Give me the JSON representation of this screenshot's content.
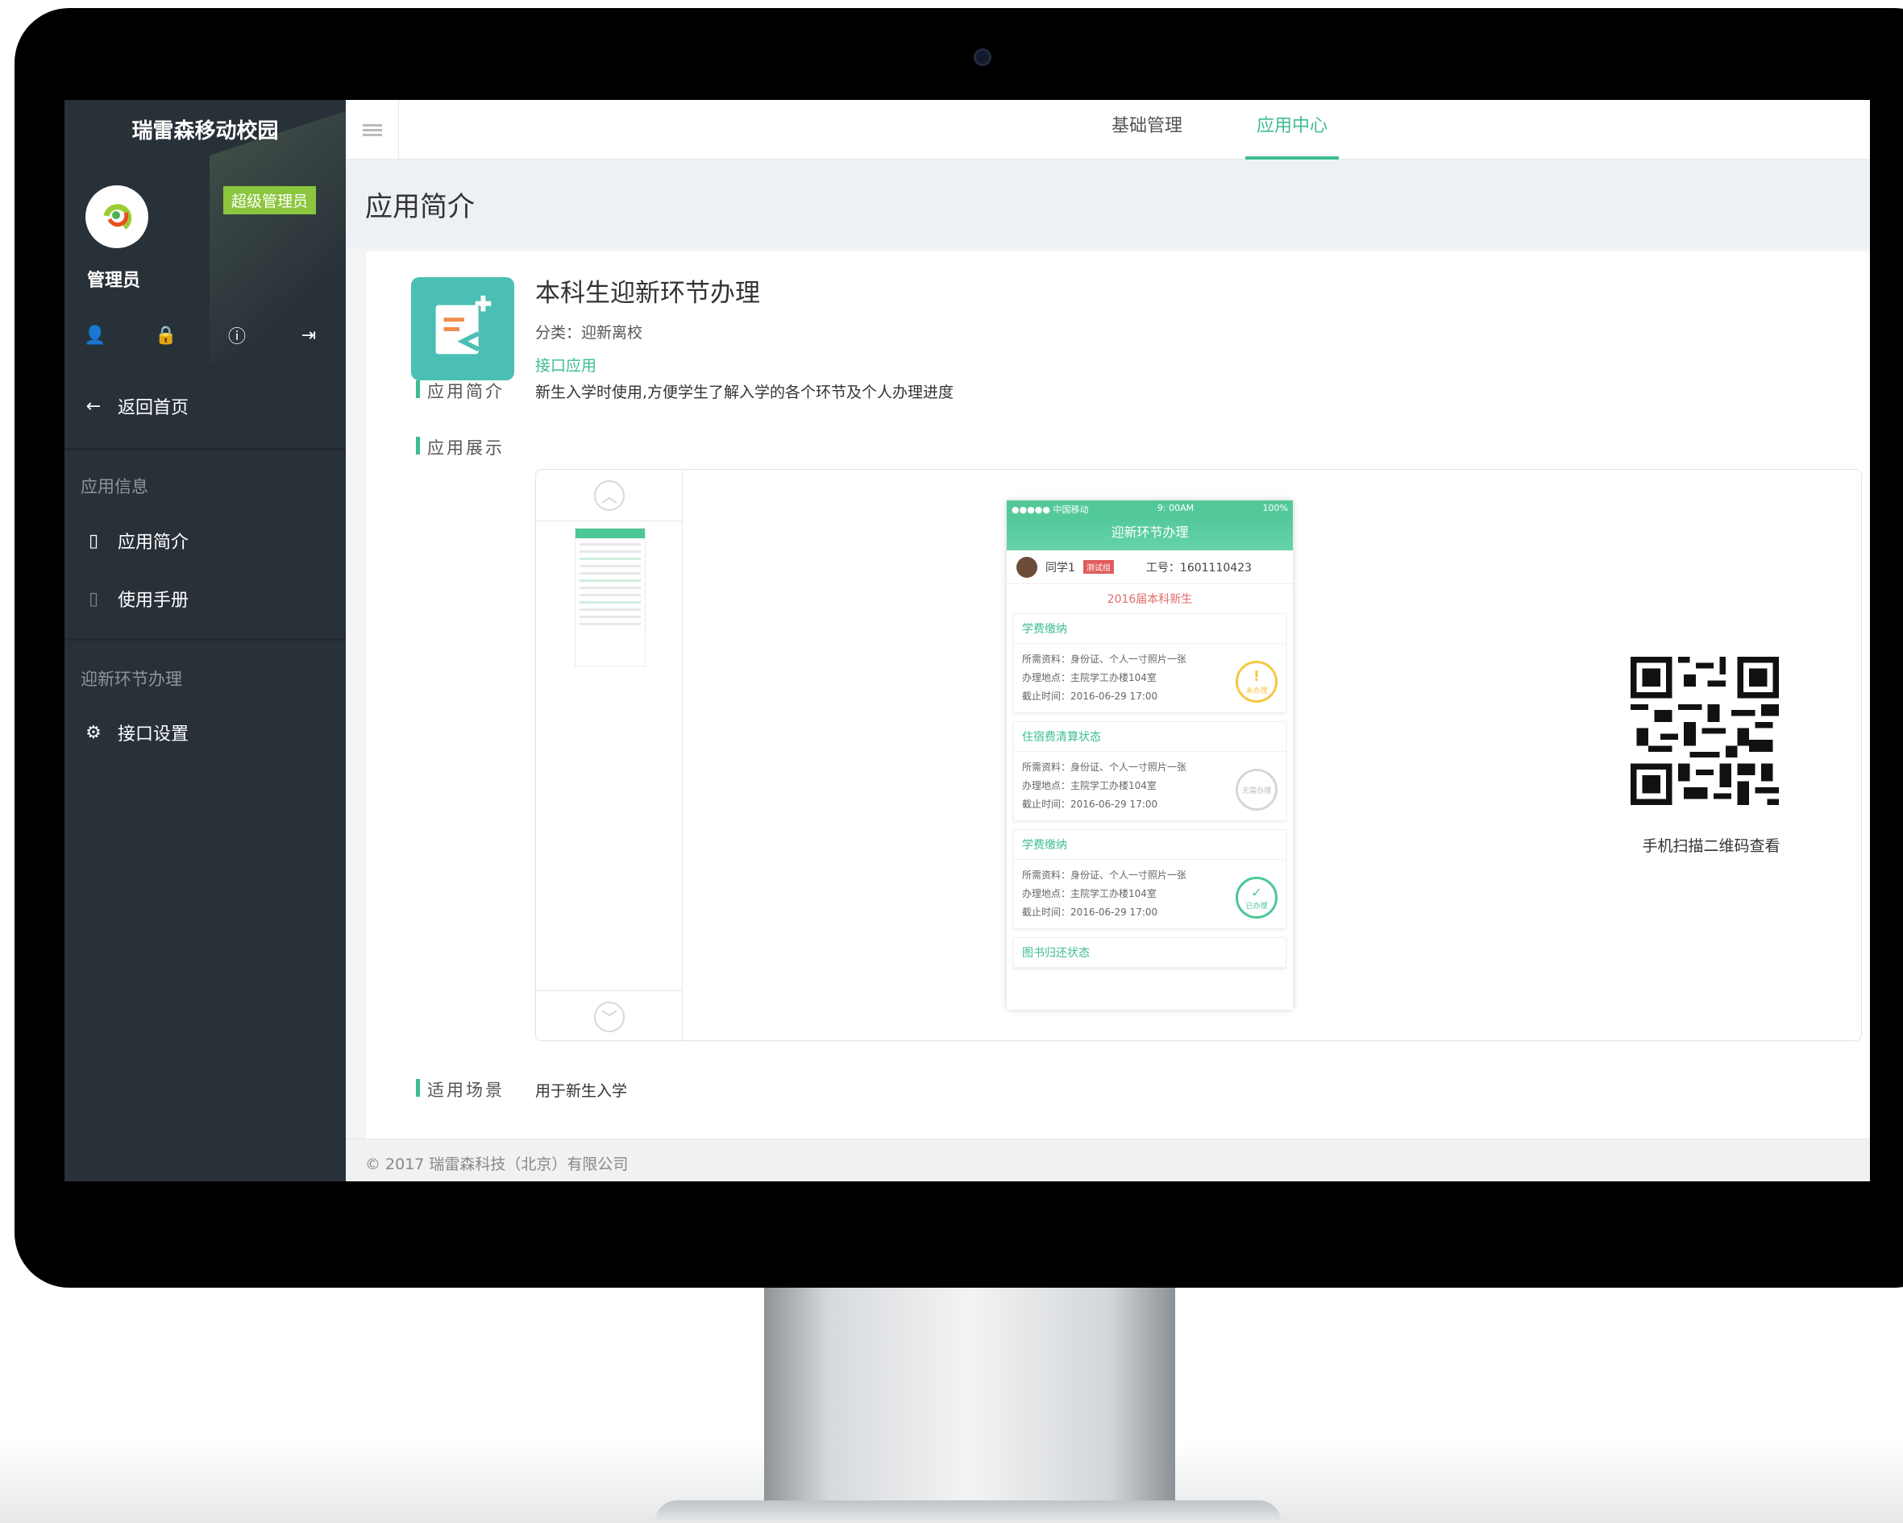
{
  "sidebar": {
    "brand": "瑞雷森移动校园",
    "badge": "超级管理员",
    "admin_name": "管理员",
    "back_label": "返回首页",
    "section_app_info": "应用信息",
    "app_intro": "应用简介",
    "app_manual": "使用手册",
    "section_welcome": "迎新环节办理",
    "api_settings": "接口设置",
    "icons": [
      "user-icon",
      "lock-icon",
      "info-icon",
      "logout-icon"
    ]
  },
  "topbar": {
    "tabs": [
      {
        "label": "基础管理"
      },
      {
        "label": "应用中心",
        "active": true
      }
    ]
  },
  "page": {
    "title": "应用简介"
  },
  "app": {
    "name": "本科生迎新环节办理",
    "category": "分类：迎新离校",
    "type_link": "接口应用",
    "intro_label": "应用简介",
    "intro_text": "新生入学时使用,方便学生了解入学的各个环节及个人办理进度",
    "showcase_label": "应用展示",
    "scene_label": "适用场景",
    "scene_text": "用于新生入学",
    "qr_caption": "手机扫描二维码查看"
  },
  "phone_preview": {
    "carrier": "●●●●● 中国移动",
    "time": "9: 00AM",
    "battery": "100%",
    "title": "迎新环节办理",
    "user_name": "同学1",
    "user_tag": "测试组",
    "work_id": "工号：1601110423",
    "grade": "2016届本科新生",
    "cards": [
      {
        "title": "学费缴纳",
        "line1": "所需资料：身份证、个人一寸照片一张",
        "line2": "办理地点：主院学工办楼104室",
        "line3": "截止时间：2016-06-29 17:00",
        "stamp": "未办理"
      },
      {
        "title": "住宿费清算状态",
        "line1": "所需资料：身份证、个人一寸照片一张",
        "line2": "办理地点：主院学工办楼104室",
        "line3": "截止时间：2016-06-29 17:00",
        "stamp": "无需办理"
      },
      {
        "title": "学费缴纳",
        "line1": "所需资料：身份证、个人一寸照片一张",
        "line2": "办理地点：主院学工办楼104室",
        "line3": "截止时间：2016-06-29 17:00",
        "stamp": "已办理"
      },
      {
        "title": "图书归还状态"
      }
    ]
  },
  "footer": {
    "copyright": "© 2017 瑞雷森科技（北京）有限公司"
  },
  "colors": {
    "accent": "#3dbd8f",
    "sidebar_bg": "#283038",
    "badge": "#8cc63f",
    "app_icon": "#4bbfb3"
  }
}
